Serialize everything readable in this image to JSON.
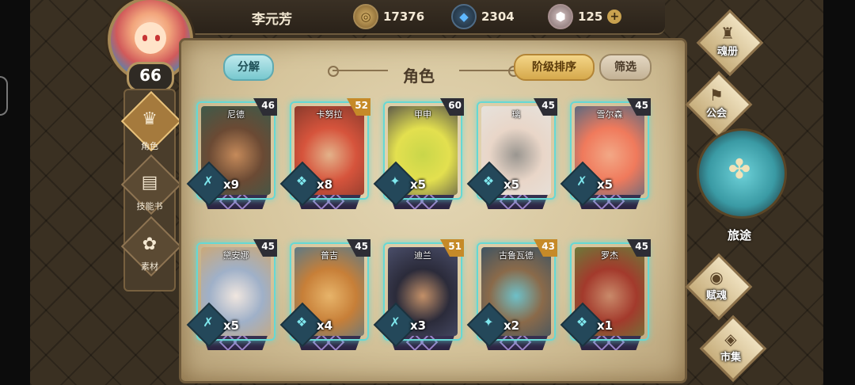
{
  "player": {
    "name": "李元芳",
    "level": "66"
  },
  "resources": [
    {
      "name": "coin-icon",
      "value": "17376"
    },
    {
      "name": "crystal-icon",
      "value": "2304"
    },
    {
      "name": "gem-icon",
      "value": "125"
    }
  ],
  "panel": {
    "title": "角色",
    "decompose_label": "分解",
    "sort_label": "阶级排序",
    "filter_label": "筛选"
  },
  "left_tabs": [
    {
      "label": "角色",
      "icon": "mask-icon",
      "glyph": "♛",
      "active": true
    },
    {
      "label": "技能书",
      "icon": "book-icon",
      "glyph": "▤",
      "active": false
    },
    {
      "label": "素材",
      "icon": "material-icon",
      "glyph": "✿",
      "active": false
    }
  ],
  "right_nav": [
    {
      "label": "魂册",
      "icon": "soul-book-icon",
      "glyph": "♜"
    },
    {
      "label": "公会",
      "icon": "guild-icon",
      "glyph": "⚑"
    },
    {
      "label": "旅途",
      "icon": "journey-icon",
      "glyph": "✤"
    },
    {
      "label": "赋魂",
      "icon": "enchant-icon",
      "glyph": "◉"
    },
    {
      "label": "市集",
      "icon": "market-icon",
      "glyph": "◈"
    }
  ],
  "characters": [
    {
      "name": "尼德",
      "level": "46",
      "count": "x9",
      "icon": "dagger-class-icon",
      "glyph": "✗",
      "level_style": "dark",
      "art": [
        "#3e5a4a",
        "#c58a5a",
        "#6b4a34"
      ]
    },
    {
      "name": "卡努拉",
      "level": "52",
      "count": "x8",
      "icon": "beast-class-icon",
      "glyph": "❖",
      "level_style": "gold",
      "art": [
        "#8a3a2c",
        "#e3b28a",
        "#d6543c"
      ]
    },
    {
      "name": "甲申",
      "level": "60",
      "count": "x5",
      "icon": "claw-class-icon",
      "glyph": "✦",
      "level_style": "dark",
      "art": [
        "#5e5a4a",
        "#c9d64a",
        "#e3e04f"
      ]
    },
    {
      "name": "璃",
      "level": "45",
      "count": "x5",
      "icon": "beast-class-icon",
      "glyph": "❖",
      "level_style": "dark",
      "art": [
        "#e6e2dc",
        "#9a9690",
        "#e9d6c8"
      ]
    },
    {
      "name": "雪尔森",
      "level": "45",
      "count": "x5",
      "icon": "dagger-class-icon",
      "glyph": "✗",
      "level_style": "dark",
      "art": [
        "#5b6a80",
        "#f2a886",
        "#f07a5c"
      ]
    },
    {
      "name": "黛安娜",
      "level": "45",
      "count": "x5",
      "icon": "dagger-class-icon",
      "glyph": "✗",
      "level_style": "dark",
      "art": [
        "#cba878",
        "#f0e6df",
        "#9fb0c8"
      ]
    },
    {
      "name": "普吉",
      "level": "45",
      "count": "x4",
      "icon": "beast-class-icon",
      "glyph": "❖",
      "level_style": "dark",
      "art": [
        "#5d7a86",
        "#e7b46a",
        "#c77f38"
      ]
    },
    {
      "name": "迪兰",
      "level": "51",
      "count": "x3",
      "icon": "dagger-class-icon",
      "glyph": "✗",
      "level_style": "gold",
      "art": [
        "#4a4e6a",
        "#c39068",
        "#2b2b3a"
      ]
    },
    {
      "name": "古鲁瓦德",
      "level": "43",
      "count": "x2",
      "icon": "claw-class-icon",
      "glyph": "✦",
      "level_style": "gold",
      "art": [
        "#3f5462",
        "#6ec0c8",
        "#8a6a4a"
      ]
    },
    {
      "name": "罗杰",
      "level": "45",
      "count": "x1",
      "icon": "beast-class-icon",
      "glyph": "❖",
      "level_style": "dark",
      "art": [
        "#6c7a3a",
        "#c98a6a",
        "#a33a2c"
      ]
    }
  ]
}
